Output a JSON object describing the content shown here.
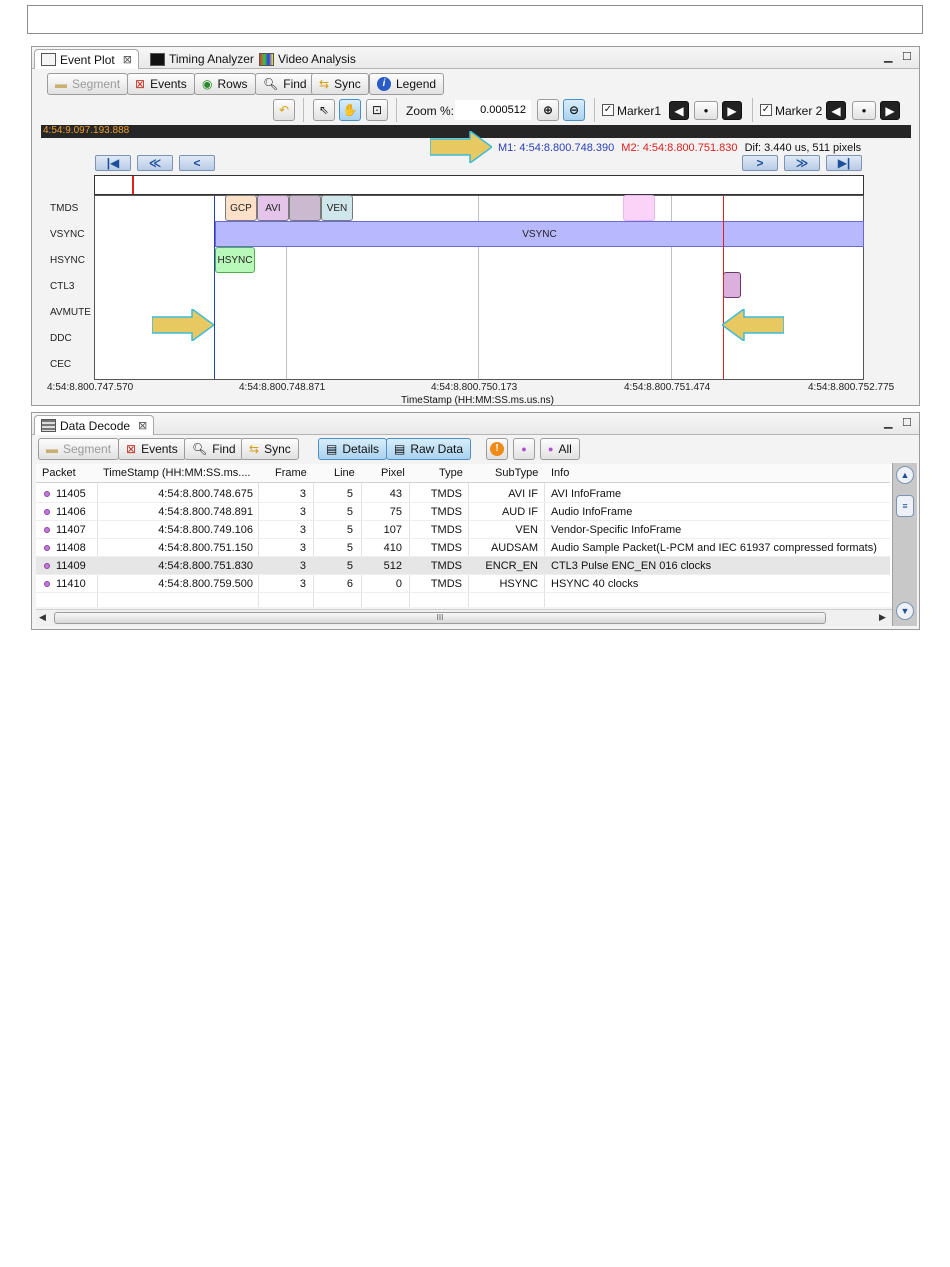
{
  "event_plot": {
    "tabs": [
      {
        "label": "Event Plot"
      },
      {
        "label": "Timing Analyzer"
      },
      {
        "label": "Video Analysis"
      }
    ],
    "toolbar1": {
      "segment": "Segment",
      "events": "Events",
      "rows": "Rows",
      "find": "Find",
      "sync": "Sync",
      "legend": "Legend"
    },
    "toolbar2": {
      "zoom_label": "Zoom %:",
      "zoom_value": "0.000512",
      "marker1": "Marker1",
      "marker2": "Marker 2"
    },
    "status_time": "4:54:9.097.193.888",
    "marker_info": {
      "m1_label": "M1:",
      "m1_value": "4:54:8.800.748.390",
      "m2_label": "M2:",
      "m2_value": "4:54:8.800.751.830",
      "dif": "Dif:  3.440 us, 511 pixels"
    },
    "rows": [
      "TMDS",
      "VSYNC",
      "HSYNC",
      "CTL3",
      "AVMUTE",
      "DDC",
      "CEC"
    ],
    "events": {
      "gcp": "GCP",
      "avi": "AVI",
      "ven": "VEN",
      "vsync": "VSYNC",
      "hsync": "HSYNC"
    },
    "axis": {
      "ticks": [
        "4:54:8.800.747.570",
        "4:54:8.800.748.871",
        "4:54:8.800.750.173",
        "4:54:8.800.751.474",
        "4:54:8.800.752.775"
      ],
      "label": "TimeStamp (HH:MM:SS.ms.us.ns)"
    }
  },
  "data_decode": {
    "tab": "Data Decode",
    "toolbar": {
      "segment": "Segment",
      "events": "Events",
      "find": "Find",
      "sync": "Sync",
      "details": "Details",
      "raw_data": "Raw Data",
      "all": "All"
    },
    "columns": [
      "Packet",
      "TimeStamp (HH:MM:SS.ms....",
      "Frame",
      "Line",
      "Pixel",
      "Type",
      "SubType",
      "Info"
    ],
    "rows": [
      {
        "packet": "11405",
        "timestamp": "4:54:8.800.748.675",
        "frame": "3",
        "line": "5",
        "pixel": "43",
        "type": "TMDS",
        "subtype": "AVI IF",
        "info": "AVI InfoFrame"
      },
      {
        "packet": "11406",
        "timestamp": "4:54:8.800.748.891",
        "frame": "3",
        "line": "5",
        "pixel": "75",
        "type": "TMDS",
        "subtype": "AUD IF",
        "info": "Audio InfoFrame"
      },
      {
        "packet": "11407",
        "timestamp": "4:54:8.800.749.106",
        "frame": "3",
        "line": "5",
        "pixel": "107",
        "type": "TMDS",
        "subtype": "VEN",
        "info": "Vendor-Specific InfoFrame"
      },
      {
        "packet": "11408",
        "timestamp": "4:54:8.800.751.150",
        "frame": "3",
        "line": "5",
        "pixel": "410",
        "type": "TMDS",
        "subtype": "AUDSAM",
        "info": "Audio Sample Packet(L-PCM and IEC 61937 compressed formats)"
      },
      {
        "packet": "11409",
        "timestamp": "4:54:8.800.751.830",
        "frame": "3",
        "line": "5",
        "pixel": "512",
        "type": "TMDS",
        "subtype": "ENCR_EN",
        "info": "CTL3 Pulse ENC_EN 016 clocks"
      },
      {
        "packet": "11410",
        "timestamp": "4:54:8.800.759.500",
        "frame": "3",
        "line": "6",
        "pixel": "0",
        "type": "TMDS",
        "subtype": "HSYNC",
        "info": "HSYNC 40 clocks"
      }
    ]
  },
  "colors": {
    "marker1": "#2a3fb5",
    "marker2": "#e02020",
    "status_bar": "#262626",
    "status_text": "#f0a030",
    "arrow": "#e8c860",
    "vsync": "#b8b8ff"
  }
}
